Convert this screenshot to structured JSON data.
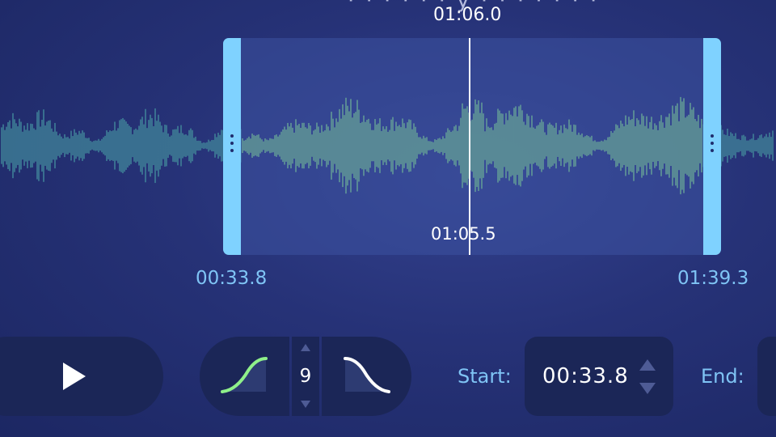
{
  "header": {
    "partial_title": "· · · · · · y · · · · · · ·"
  },
  "timeline": {
    "playhead_time": "01:06.0",
    "cursor_time": "01:05.5",
    "selection_start": "00:33.8",
    "selection_end": "01:39.3"
  },
  "fade": {
    "length": "9"
  },
  "controls": {
    "start_label": "Start:",
    "start_value": "00:33.8",
    "end_label": "End:"
  },
  "colors": {
    "background": "#263277",
    "selection_handle": "#7fd2ff",
    "waveform_selected": "#8ff08a",
    "waveform_unselected": "#3f7f97",
    "accent_text": "#7fc4f5",
    "panel": "#1b2657"
  },
  "icons": {
    "play": "play-icon",
    "fade_in": "fade-in-icon",
    "fade_out": "fade-out-icon"
  }
}
